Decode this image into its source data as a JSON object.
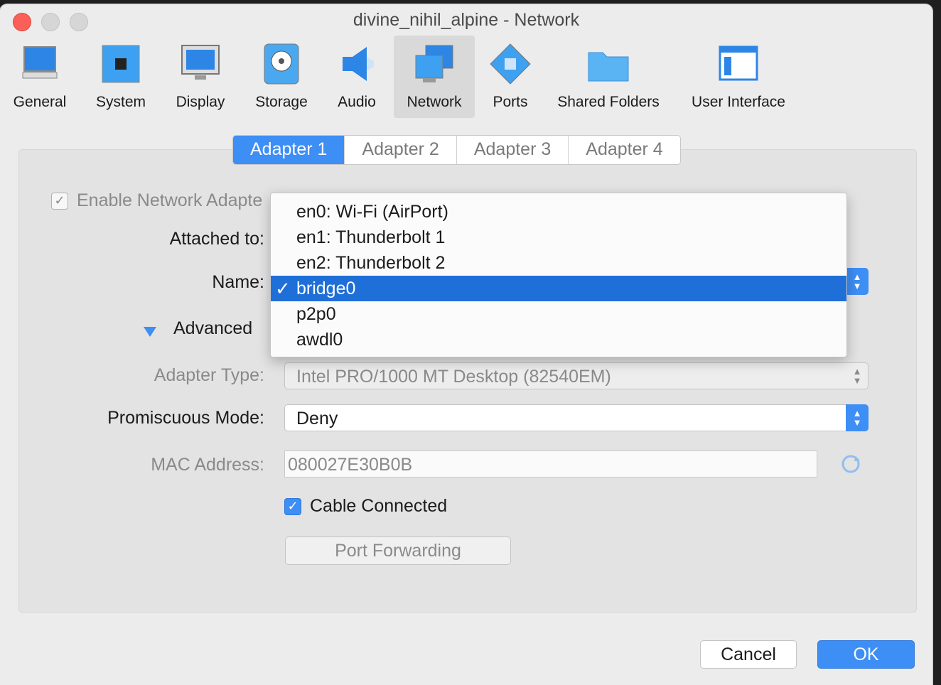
{
  "window": {
    "title": "divine_nihil_alpine - Network"
  },
  "toolbar": {
    "items": [
      {
        "label": "General",
        "icon": "monitor-icon"
      },
      {
        "label": "System",
        "icon": "chip-icon"
      },
      {
        "label": "Display",
        "icon": "display-icon"
      },
      {
        "label": "Storage",
        "icon": "disk-icon"
      },
      {
        "label": "Audio",
        "icon": "speaker-icon"
      },
      {
        "label": "Network",
        "icon": "network-icon",
        "active": true
      },
      {
        "label": "Ports",
        "icon": "ports-icon"
      },
      {
        "label": "Shared Folders",
        "icon": "folder-icon"
      },
      {
        "label": "User Interface",
        "icon": "window-icon"
      }
    ]
  },
  "tabs": [
    {
      "label": "Adapter 1",
      "active": true
    },
    {
      "label": "Adapter 2"
    },
    {
      "label": "Adapter 3"
    },
    {
      "label": "Adapter 4"
    }
  ],
  "form": {
    "enable_label": "Enable Network Adapte",
    "attached_label": "Attached to:",
    "name_label": "Name:",
    "advanced_label": "Advanced",
    "adapter_type_label": "Adapter Type:",
    "adapter_type_value": "Intel PRO/1000 MT Desktop (82540EM)",
    "promiscuous_label": "Promiscuous Mode:",
    "promiscuous_value": "Deny",
    "mac_label": "MAC Address:",
    "mac_value": "080027E30B0B",
    "cable_label": "Cable Connected",
    "port_forwarding_label": "Port Forwarding"
  },
  "name_menu": {
    "options": [
      "en0: Wi-Fi (AirPort)",
      "en1: Thunderbolt 1",
      "en2: Thunderbolt 2",
      "bridge0",
      "p2p0",
      "awdl0"
    ],
    "selected": "bridge0",
    "check_glyph": "✓"
  },
  "buttons": {
    "cancel": "Cancel",
    "ok": "OK"
  },
  "colors": {
    "accent": "#3d8ef5",
    "selection": "#1f6fd8",
    "close": "#fc5f57"
  }
}
